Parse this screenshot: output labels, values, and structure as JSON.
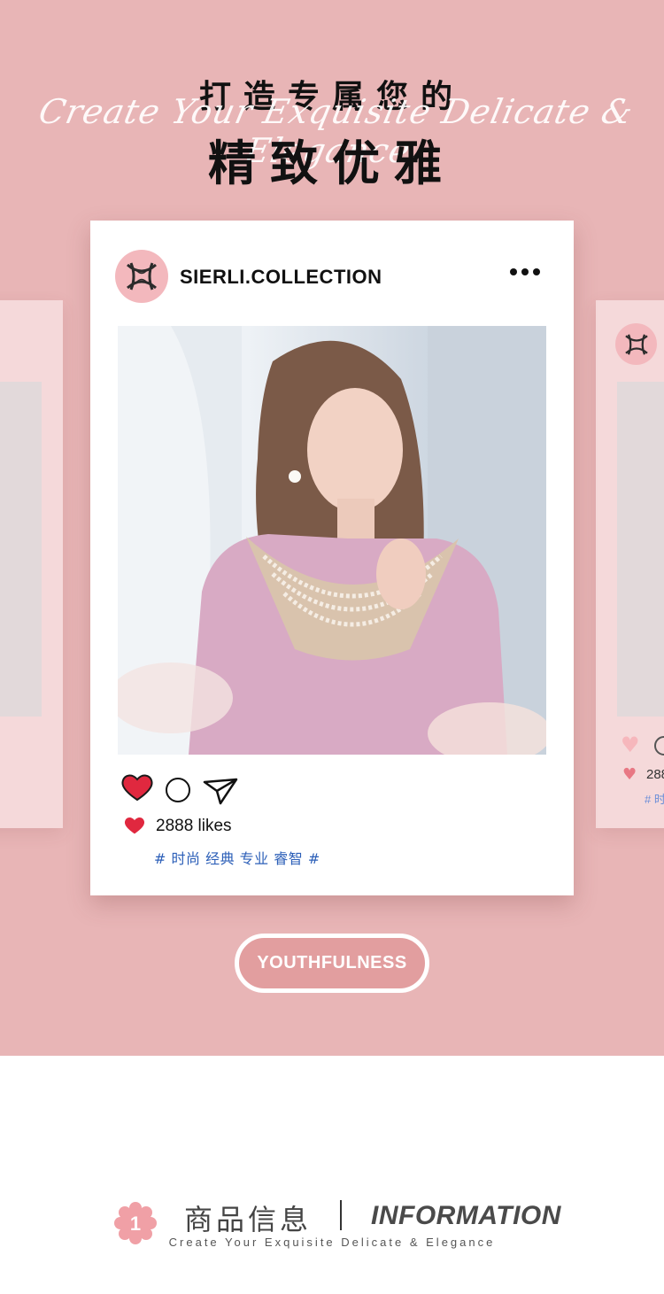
{
  "header": {
    "line1": "打造专属您的",
    "script": "Create Your Exquisite Delicate & Elegance",
    "line2": "精致优雅"
  },
  "post": {
    "account_name": "SIERLI.COLLECTION",
    "more_icon": "more-dots-icon",
    "likes_text": "2888 likes",
    "tags": "# 时尚 经典 专业 睿智 #",
    "like_color": "#e0283f"
  },
  "side_post": {
    "likes_text": "288",
    "tags": "# 时"
  },
  "badge": {
    "label": "YOUTHFULNESS"
  },
  "info_section": {
    "number": "1",
    "title_zh": "商品信息",
    "title_en": "INFORMATION",
    "subtitle": "Create Your Exquisite Delicate & Elegance"
  },
  "colors": {
    "background_pink": "#e8b5b6",
    "card_pink": "#f5d9da",
    "logo_pink": "#f3b8bd",
    "tag_blue": "#2c5fb8"
  }
}
